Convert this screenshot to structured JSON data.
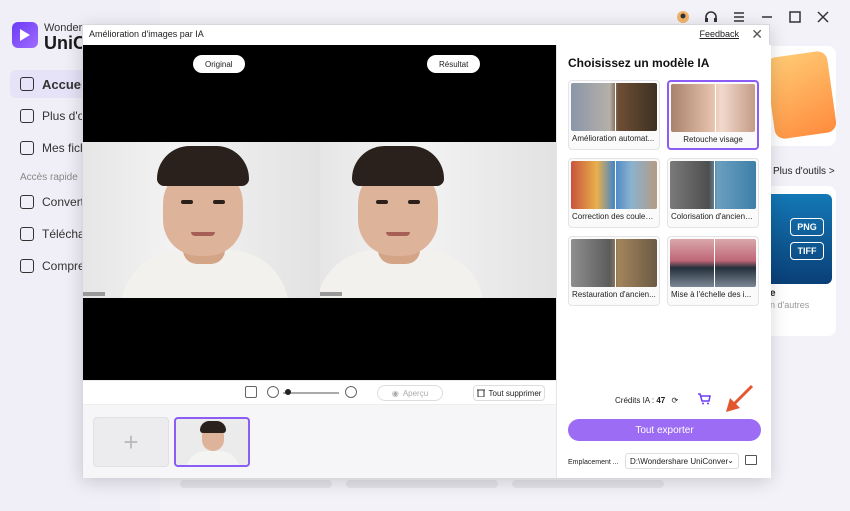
{
  "app": {
    "brand_top": "Wonders",
    "brand_main": "UniCo",
    "nav": [
      {
        "label": "Accueil",
        "icon": "home-icon",
        "active": true
      },
      {
        "label": "Plus d'ou",
        "icon": "toolbox-icon"
      },
      {
        "label": "Mes fichi",
        "icon": "files-icon"
      }
    ],
    "quick_access_label": "Accès rapide",
    "quick": [
      {
        "label": "Converti",
        "icon": "convert-icon"
      },
      {
        "label": "Téléchar",
        "icon": "download-icon"
      },
      {
        "label": "Compres",
        "icon": "compress-icon"
      }
    ],
    "more_tools_label": "Plus d'outils >",
    "card2_title": "e",
    "card2_sub": "n d'autres",
    "formats": [
      "PNG",
      "TIFF"
    ]
  },
  "modal": {
    "title": "Amélioration d'images par IA",
    "feedback_label": "Feedback",
    "close_glyph": "✕",
    "original_label": "Original",
    "result_label": "Résultat",
    "apercu_label": "Aperçu",
    "delete_all_label": "Tout supprimer",
    "add_glyph": "+",
    "panel_title": "Choisissez un modèle IA",
    "models": [
      {
        "label": "Amélioration automat...",
        "selected": false,
        "gradient": "linear-gradient(90deg,#8a96a8,#b5b0a8 45%,#6e4f34 55%,#3d3023)"
      },
      {
        "label": "Retouche visage",
        "selected": true,
        "gradient": "linear-gradient(90deg,#a9826d,#e6c2ad 50%,#f1d9cc 60%,#c49c86)"
      },
      {
        "label": "Correction des couleurs",
        "selected": false,
        "gradient": "linear-gradient(90deg,#c9533b,#e8b04c 30%,#4a87c3 50%,#8ab2cf 70%,#b59b84)"
      },
      {
        "label": "Colorisation d'ancienn...",
        "selected": false,
        "gradient": "linear-gradient(90deg,#7a7a7a,#4e4e4e 45%,#6a9fc0 55%,#3e7fa8)"
      },
      {
        "label": "Restauration d'ancien...",
        "selected": false,
        "gradient": "linear-gradient(90deg,#8f8f8f,#5c5c5c 45%,#a3845b 55%,#6b5a45)"
      },
      {
        "label": "Mise à l'échelle des i...",
        "selected": false,
        "gradient": "linear-gradient(180deg,#d9a7a9,#c06778 45%,#24303b 60%,#7b8794)"
      }
    ],
    "credits_label": "Crédits IA : ",
    "credits_value": "47",
    "export_label": "Tout exporter",
    "location_label": "Emplacement ...",
    "location_value": "D:\\Wondershare UniConver"
  }
}
